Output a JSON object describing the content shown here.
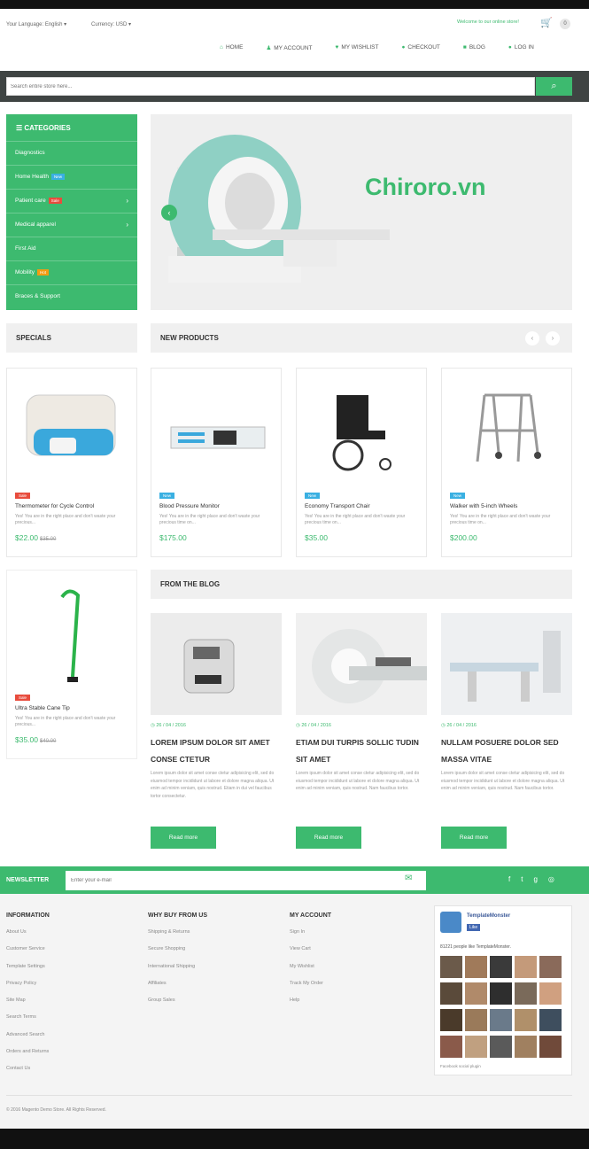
{
  "header": {
    "language": "Your Language: English",
    "currency": "Currency: USD",
    "welcome": "Welcome to our online store!",
    "cart_count": "0"
  },
  "nav": [
    {
      "icon": "⌂",
      "label": "HOME"
    },
    {
      "icon": "♟",
      "label": "MY ACCOUNT"
    },
    {
      "icon": "♥",
      "label": "MY WISHLIST"
    },
    {
      "icon": "●",
      "label": "CHECKOUT"
    },
    {
      "icon": "■",
      "label": "BLOG"
    },
    {
      "icon": "●",
      "label": "LOG IN"
    }
  ],
  "search": {
    "placeholder": "Search entire store here..."
  },
  "categories": {
    "title": "CATEGORIES",
    "items": [
      {
        "label": "Diagnostics",
        "tag": "",
        "arrow": ""
      },
      {
        "label": "Home Health",
        "tag": "New",
        "arrow": ""
      },
      {
        "label": "Patient care",
        "tag": "Sale",
        "arrow": "›"
      },
      {
        "label": "Medical apparel",
        "tag": "",
        "arrow": "›"
      },
      {
        "label": "First Aid",
        "tag": "",
        "arrow": ""
      },
      {
        "label": "Mobility",
        "tag": "Hot",
        "arrow": ""
      },
      {
        "label": "Braces & Support",
        "tag": "",
        "arrow": ""
      }
    ]
  },
  "watermark": "Chiroro.vn",
  "sections": {
    "specials": "SPECIALS",
    "new_products": "NEW PRODUCTS",
    "blog": "FROM THE BLOG"
  },
  "products": [
    {
      "name": "Thermometer for Cycle Control",
      "badge": "Sale",
      "desc": "Yes! You are in the right place and don't waste your precious...",
      "price": "$22.00",
      "old": "$35.00"
    },
    {
      "name": "Blood Pressure Monitor",
      "badge": "New",
      "desc": "Yes! You are in the right place and don't waste your precious time on...",
      "price": "$175.00",
      "old": ""
    },
    {
      "name": "Economy Transport Chair",
      "badge": "New",
      "desc": "Yes! You are in the right place and don't waste your precious time on...",
      "price": "$35.00",
      "old": ""
    },
    {
      "name": "Walker with 5-inch Wheels",
      "badge": "New",
      "desc": "Yes! You are in the right place and don't waste your precious time on...",
      "price": "$200.00",
      "old": ""
    },
    {
      "name": "Ultra Stable Cane Tip",
      "badge": "Sale",
      "desc": "Yes! You are in the right place and don't waste your precious...",
      "price": "$35.00",
      "old": "$40.00"
    }
  ],
  "blog": [
    {
      "date": "26 / 04 / 2016",
      "title": "LOREM IPSUM DOLOR SIT AMET CONSE CTETUR",
      "text": "Lorem ipsum dolor sit amet conse ctetur adipisicing elit, sed do eiusmod tempor incididunt ut labore et dolore magna aliqua. Ut enim ad minim veniam, quis nostrud. Etiam in dui vel faucibus tortor consectetur.",
      "button": "Read more"
    },
    {
      "date": "26 / 04 / 2016",
      "title": "ETIAM DUI TURPIS SOLLIC TUDIN SIT AMET",
      "text": "Lorem ipsum dolor sit amet conse ctetur adipisicing elit, sed do eiusmod tempor incididunt ut labore et dolore magna aliqua. Ut enim ad minim veniam, quis nostrud. Nam faucibus tortor.",
      "button": "Read more"
    },
    {
      "date": "26 / 04 / 2016",
      "title": "NULLAM POSUERE DOLOR SED MASSA VITAE",
      "text": "Lorem ipsum dolor sit amet conse ctetur adipisicing elit, sed do eiusmod tempor incididunt ut labore et dolore magna aliqua. Ut enim ad minim veniam, quis nostrud. Nam faucibus tortor.",
      "button": "Read more"
    }
  ],
  "newsletter": {
    "title": "NEWSLETTER",
    "placeholder": "Enter your e-mail"
  },
  "footer": {
    "cols": [
      {
        "title": "INFORMATION",
        "links": [
          "About Us",
          "Customer Service",
          "Template Settings",
          "Privacy Policy",
          "Site Map",
          "Search Terms",
          "Advanced Search",
          "Orders and Returns",
          "Contact Us"
        ]
      },
      {
        "title": "WHY BUY FROM US",
        "links": [
          "Shipping & Returns",
          "Secure Shopping",
          "International Shipping",
          "Affiliates",
          "Group Sales"
        ]
      },
      {
        "title": "MY ACCOUNT",
        "links": [
          "Sign In",
          "View Cart",
          "My Wishlist",
          "Track My Order",
          "Help"
        ]
      }
    ],
    "fb": {
      "page": "TemplateMonster",
      "like": "Like",
      "count": "81221 people like TemplateMonster.",
      "plugin": "Facebook social plugin"
    },
    "copyright": "© 2016 Magento Demo Store. All Rights Reserved."
  }
}
